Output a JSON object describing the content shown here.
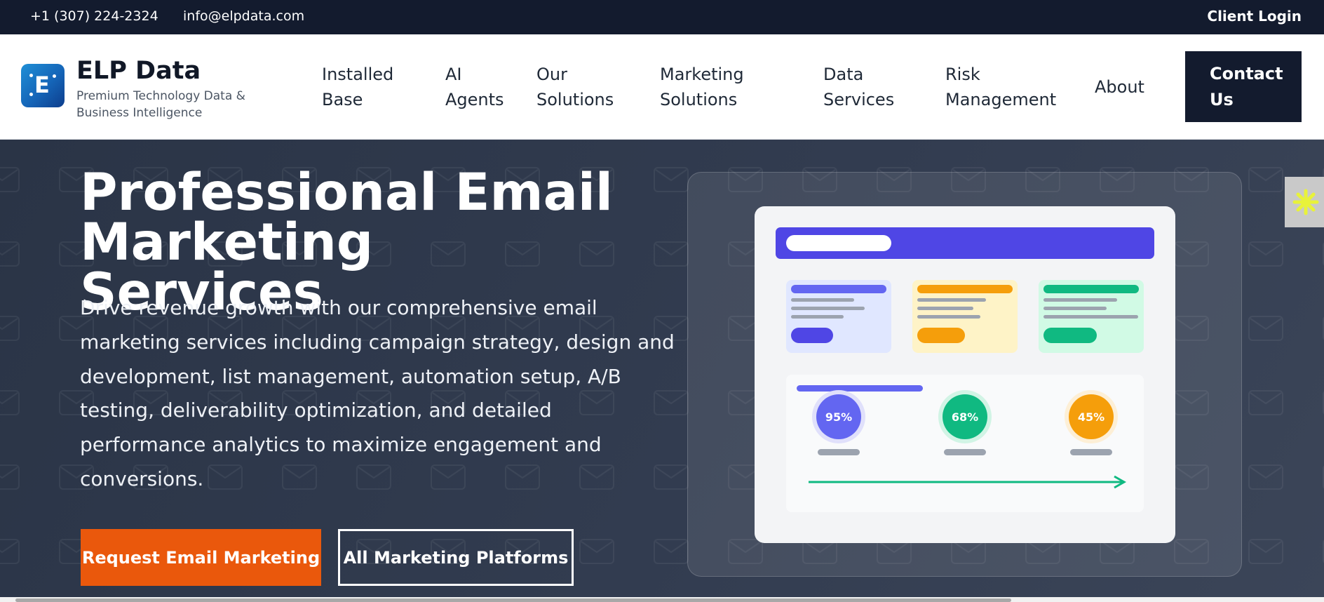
{
  "topbar": {
    "phone": "+1 (307) 224-2324",
    "email": "info@elpdata.com",
    "client_login": "Client Login"
  },
  "header": {
    "logo_letter": "E",
    "brand_name": "ELP Data",
    "tagline": "Premium Technology Data & Business Intelligence",
    "nav": [
      {
        "line1": "Installed",
        "line2": "Base"
      },
      {
        "line1": "AI",
        "line2": "Agents"
      },
      {
        "line1": "Our",
        "line2": "Solutions"
      },
      {
        "line1": "Marketing",
        "line2": "Solutions"
      },
      {
        "line1": "Data",
        "line2": "Services"
      },
      {
        "line1": "Risk",
        "line2": "Management"
      },
      {
        "line1": "About",
        "line2": ""
      }
    ],
    "contact": {
      "line1": "Contact",
      "line2": "Us"
    }
  },
  "hero": {
    "title_line1": "Professional Email",
    "title_line2": "Marketing Services",
    "description_lines": [
      "Drive revenue growth with our comprehensive email",
      "marketing services including campaign strategy, design and",
      "development, list management, automation setup, A/B",
      "testing, deliverability optimization, and detailed",
      "performance analytics to maximize engagement and",
      "conversions."
    ],
    "primary_button": "Request Email Marketing",
    "secondary_button": "All Marketing Platforms"
  },
  "illustration": {
    "stats": [
      {
        "value": "95%",
        "color": "#6366f1",
        "ring": "#e0e0fb"
      },
      {
        "value": "68%",
        "color": "#10b981",
        "ring": "#d1f4e5"
      },
      {
        "value": "45%",
        "color": "#f59e0b",
        "ring": "#fdefd6"
      }
    ],
    "mini_cards": [
      {
        "bg": "#e0e7ff",
        "accent": "#6366f1",
        "pill": "#4f46e5"
      },
      {
        "bg": "#fef3c7",
        "accent": "#f59e0b",
        "pill": "#f59e0b"
      },
      {
        "bg": "#d1fae5",
        "accent": "#10b981",
        "pill": "#10b981"
      }
    ]
  },
  "colors": {
    "brand_dark": "#131b2e",
    "accent_orange": "#ea580c",
    "accent_indigo": "#4f46e5",
    "widget_asterisk": "#e8f23a"
  }
}
